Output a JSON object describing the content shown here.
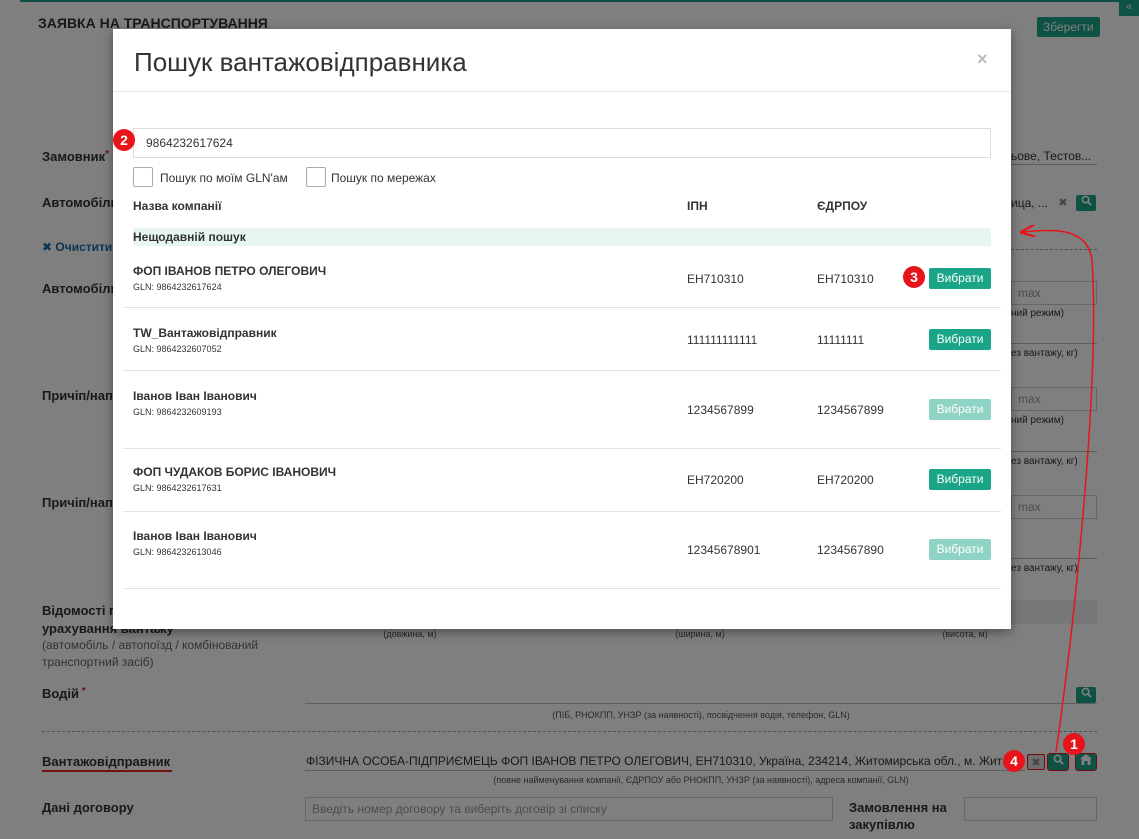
{
  "page": {
    "title": "ЗАЯВКА НА ТРАНСПОРТУВАННЯ",
    "save_label": "Зберегти",
    "collapse_icon": "«",
    "customer_label": "Замовник",
    "customer_value": "ьове, Тестов...",
    "vehicle_label": "Автомобіль",
    "vehicle_value": "ица, ...",
    "clear_label": "✖ Очистити",
    "vehicle2_label": "Автомобіль",
    "trailer1_label": "Причіп/нап",
    "trailer2_label": "Причіп/нап",
    "max_placeholder": "max",
    "side_note1": "ний режим)",
    "side_note2": "ез вантажу, кг)",
    "side_note3": "ний режим)",
    "side_note4": "ез вантажу, кг)",
    "side_note5": "ез вантажу, кг)",
    "dims_label_a": "Відомості п",
    "dims_label_b": "урахування вантажу",
    "dims_label_c": "(автомобіль / автопоїзд / комбінований",
    "dims_label_d": "транспортний засіб)",
    "dim_length": "(довжина, м)",
    "dim_width": "(ширина, м)",
    "dim_height": "(висота, м)",
    "driver_label": "Водій",
    "driver_hint": "(ПІБ, РНОКПП, УНЗР (за наявності), посвідчення водія, телефон, GLN)",
    "shipper_label": "Вантажовідправник",
    "shipper_value": "ФІЗИЧНА ОСОБА-ПІДПРИЄМЕЦЬ ФОП ІВАНОВ ПЕТРО ОЛЕГОВИЧ, ЕН710310, Україна, 234214, Житомирська обл., м. Жит",
    "shipper_hint": "(повне найменування компанії, ЄДРПОУ або РНОКПП, УНЗР (за наявності), адреса компанії, GLN)",
    "contract_label": "Дані договору",
    "contract_placeholder": "Введіть номер договору та виберіть договір зі списку",
    "purchase_label_a": "Замовлення на",
    "purchase_label_b": "закупівлю"
  },
  "modal": {
    "title": "Пошук вантажовідправника",
    "close": "×",
    "search_value": "9864232617624",
    "check_gln_label": "Пошук по моїм GLN'ам",
    "check_network_label": "Пошук по мережах",
    "col_company": "Назва компанії",
    "col_ipn": "ІПН",
    "col_edrpou": "ЄДРПОУ",
    "recent_label": "Нещодавній пошук",
    "choose_label": "Вибрати",
    "rows": [
      {
        "name": "ФОП ІВАНОВ ПЕТРО ОЛЕГОВИЧ",
        "gln": "GLN: 9864232617624",
        "ipn": "ЕН710310",
        "edrpou": "ЕН710310",
        "enabled": true
      },
      {
        "name": "TW_Вантажовідправник",
        "gln": "GLN: 9864232607052",
        "ipn": "111111111111",
        "edrpou": "11111111",
        "enabled": true
      },
      {
        "name": "Іванов Іван Іванович",
        "gln": "GLN: 9864232609193",
        "ipn": "1234567899",
        "edrpou": "1234567899",
        "enabled": false
      },
      {
        "name": "ФОП ЧУДАКОВ БОРИС ІВАНОВИЧ",
        "gln": "GLN: 9864232617631",
        "ipn": "ЕН720200",
        "edrpou": "ЕН720200",
        "enabled": true
      },
      {
        "name": "Іванов Іван Іванович",
        "gln": "GLN: 9864232613046",
        "ipn": "12345678901",
        "edrpou": "1234567890",
        "enabled": false
      }
    ]
  },
  "annotations": {
    "badge1": "1",
    "badge2": "2",
    "badge3": "3",
    "badge4": "4",
    "color": "#e8141b"
  },
  "icons": {
    "search": "search-icon",
    "clear": "clear-icon",
    "home": "home-icon"
  }
}
